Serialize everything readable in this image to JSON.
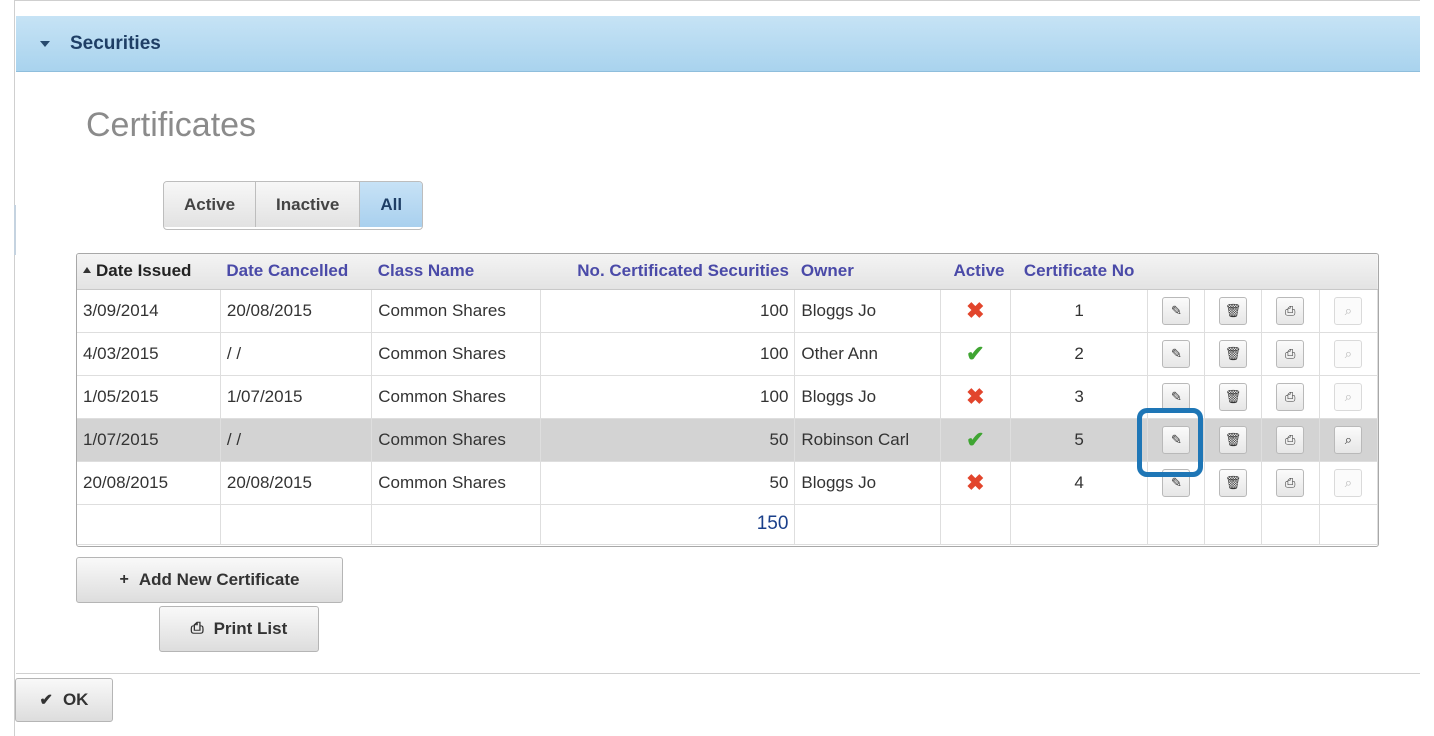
{
  "panel": {
    "title": "Securities"
  },
  "page": {
    "heading": "Certificates"
  },
  "filters": [
    {
      "label": "Active",
      "selected": false
    },
    {
      "label": "Inactive",
      "selected": false
    },
    {
      "label": "All",
      "selected": true
    }
  ],
  "table": {
    "columns": [
      "Date Issued",
      "Date Cancelled",
      "Class Name",
      "No. Certificated Securities",
      "Owner",
      "Active",
      "Certificate No"
    ],
    "sorted_column": "Date Issued",
    "rows": [
      {
        "date_issued": "3/09/2014",
        "date_cancelled": "20/08/2015",
        "class_name": "Common Shares",
        "securities": "100",
        "owner": "Bloggs Jo",
        "active": false,
        "certificate_no": "1"
      },
      {
        "date_issued": "4/03/2015",
        "date_cancelled": "/ /",
        "class_name": "Common Shares",
        "securities": "100",
        "owner": "Other Ann",
        "active": true,
        "certificate_no": "2"
      },
      {
        "date_issued": "1/05/2015",
        "date_cancelled": "1/07/2015",
        "class_name": "Common Shares",
        "securities": "100",
        "owner": "Bloggs Jo",
        "active": false,
        "certificate_no": "3"
      },
      {
        "date_issued": "1/07/2015",
        "date_cancelled": "/ /",
        "class_name": "Common Shares",
        "securities": "50",
        "owner": "Robinson Carl",
        "active": true,
        "certificate_no": "5",
        "selected": true
      },
      {
        "date_issued": "20/08/2015",
        "date_cancelled": "20/08/2015",
        "class_name": "Common Shares",
        "securities": "50",
        "owner": "Bloggs Jo",
        "active": false,
        "certificate_no": "4"
      }
    ],
    "total_securities": "150",
    "icons": {
      "active_yes": "✔",
      "active_no": "✖",
      "edit": "✎",
      "delete": "🗑",
      "print": "⎙",
      "view": "⌕"
    }
  },
  "buttons": {
    "add_label": "Add New Certificate",
    "add_icon": "+",
    "print_label": "Print List",
    "print_icon": "⎙",
    "ok_label": "OK",
    "ok_icon": "✔"
  }
}
